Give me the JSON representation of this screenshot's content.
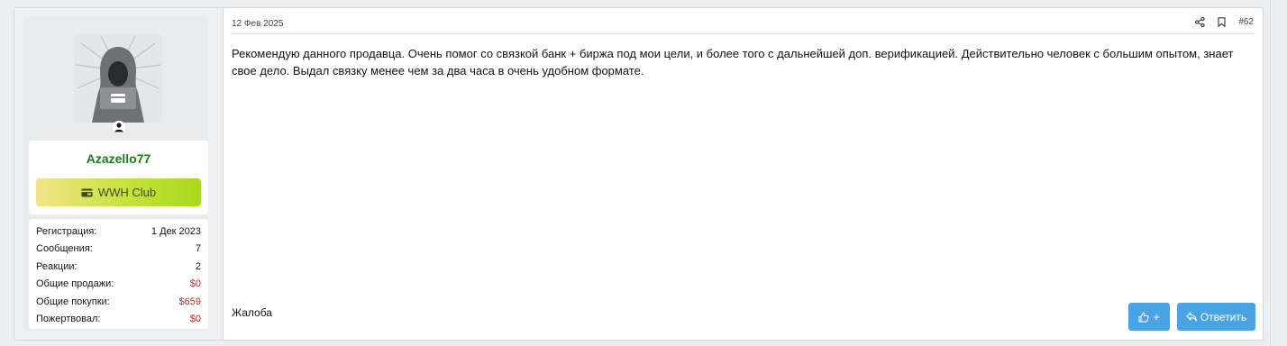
{
  "post": {
    "date": "12 Фев 2025",
    "number": "#62",
    "message": "Рекомендую данного продавца. Очень помог со связкой банк + биржа под мои цели, и более того с дальнейшей доп. верификацией. Действительно человек с большим опытом, знает свое дело. Выдал связку менее чем за два часа в очень удобном формате.",
    "report_label": "Жалоба",
    "like_label": "+",
    "reply_label": "Ответить"
  },
  "user": {
    "name": "Azazello77",
    "banner": "WWH Club",
    "stats": [
      {
        "label": "Регистрация:",
        "value": "1 Дек 2023"
      },
      {
        "label": "Сообщения:",
        "value": "7"
      },
      {
        "label": "Реакции:",
        "value": "2"
      },
      {
        "label": "Общие продажи:",
        "value": "$0"
      },
      {
        "label": "Общие покупки:",
        "value": "$659"
      },
      {
        "label": "Пожертвовал:",
        "value": "$0"
      }
    ]
  },
  "colors": {
    "username": "#1a7d1a",
    "money_value": "#e01b1b",
    "button": "#4aa3e3"
  },
  "icons": {
    "share": "share-icon",
    "bookmark": "bookmark-icon",
    "like": "thumbs-up-icon",
    "reply": "reply-icon",
    "banner": "card-icon",
    "online": "user-online-icon"
  }
}
